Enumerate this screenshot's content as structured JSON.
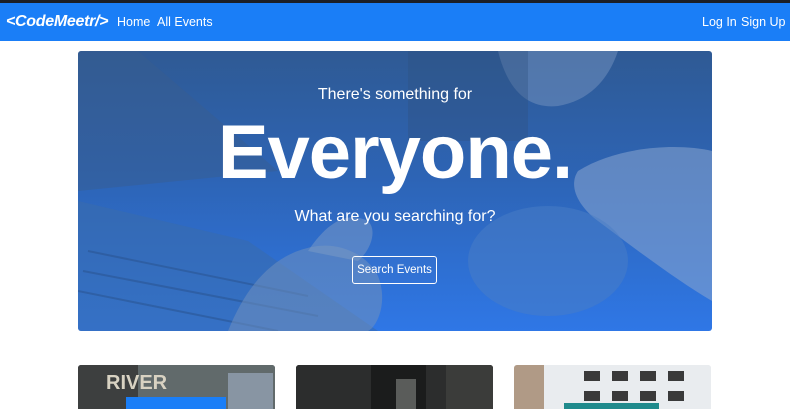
{
  "navbar": {
    "brand": "<CodeMeetr/>",
    "links": [
      "Home",
      "All Events"
    ],
    "auth": [
      "Log In",
      "Sign Up"
    ],
    "color": "#1a7ef7"
  },
  "hero": {
    "tagline": "There's something for",
    "title": "Everyone.",
    "question": "What are you searching for?",
    "button": "Search Events"
  },
  "cards": [
    {
      "image": "office-photo",
      "sign": "RIVER"
    },
    {
      "image": "hallway-photo"
    },
    {
      "image": "store-photo"
    }
  ]
}
